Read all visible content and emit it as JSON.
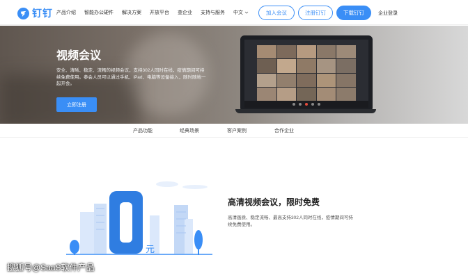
{
  "nav": {
    "logo_text": "钉钉",
    "links": [
      "产品介绍",
      "智能办公硬件",
      "解决方案",
      "开放平台",
      "查企业",
      "支持与服务"
    ],
    "lang": "中文",
    "join_label": "加入会议",
    "signup_label": "注册钉钉",
    "download_label": "下载钉钉",
    "enterprise_label": "企业登录"
  },
  "hero": {
    "title": "视频会议",
    "desc": "安全、清晰、稳定、流畅的视频会议，支持302人同时在线，疫情期间可持续免费使用。参会人员可以通过手机、iPad、电脑等设备接入，随时随地一起开会。",
    "cta_label": "立即注册"
  },
  "subnav": {
    "items": [
      "产品功能",
      "经典场景",
      "客户案例",
      "合作企业"
    ]
  },
  "feature": {
    "big_number": "0",
    "unit": "元",
    "title": "高清视频会议，限时免费",
    "desc": "高清画质、稳定流畅、最高支持302人同时在线，疫情期间可持续免费使用。"
  },
  "watermark": "搜狐号@SaaS软件产品",
  "colors": {
    "accent": "#3a8ef6"
  }
}
